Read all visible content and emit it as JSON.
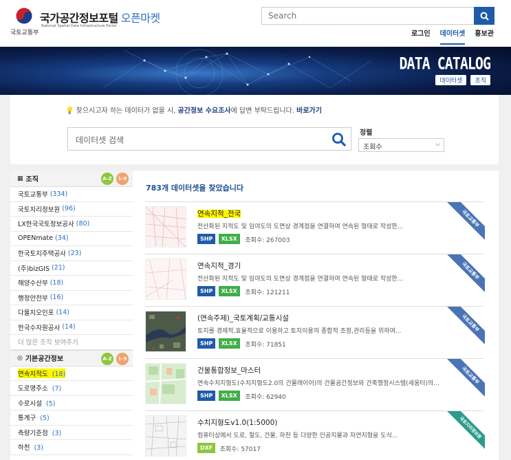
{
  "header": {
    "ministry": "국토교통부",
    "title_main": "국가공간정보포털",
    "title_market": "오픈마켓",
    "subtitle": "National Spatial Data Infrastructure Portal",
    "search_placeholder": "Search",
    "nav": [
      {
        "label": "로그인",
        "active": false
      },
      {
        "label": "데이터셋",
        "active": true
      },
      {
        "label": "홍보관",
        "active": false
      }
    ]
  },
  "banner": {
    "title": "DATA CATALOG",
    "buttons": [
      "데이터셋",
      "조직"
    ]
  },
  "search_panel": {
    "survey_pre": "찾으시고자 하는 데이터가 없을 시, ",
    "survey_link": "공간정보 수요조사",
    "survey_mid": "에 답변 부탁드립니다. ",
    "survey_go": "바로가기",
    "placeholder": "데이터셋 검색",
    "sort_label": "정렬",
    "sort_value": "조회수"
  },
  "sidebar": {
    "org_header": "조직",
    "badge_az": "A-Z",
    "badge_19": "1-9",
    "orgs": [
      {
        "name": "국토교통부",
        "count": "(334)"
      },
      {
        "name": "국토지리정보원",
        "count": "(96)"
      },
      {
        "name": "LX한국국토정보공사",
        "count": "(80)"
      },
      {
        "name": "OPENmate",
        "count": "(34)"
      },
      {
        "name": "한국토지주택공사",
        "count": "(23)"
      },
      {
        "name": "(주)bizGIS",
        "count": "(21)"
      },
      {
        "name": "해양수산부",
        "count": "(18)"
      },
      {
        "name": "행정안전부",
        "count": "(16)"
      },
      {
        "name": "다울지오인포",
        "count": "(14)"
      },
      {
        "name": "한국수자원공사",
        "count": "(14)"
      }
    ],
    "more": "더 많은 조직 보여주기",
    "cat_header": "기본공간정보",
    "cats": [
      {
        "name": "연속지적도",
        "count": "(18)",
        "highlight": true
      },
      {
        "name": "도로명주소",
        "count": "(7)",
        "highlight": false
      },
      {
        "name": "수로시설",
        "count": "(5)",
        "highlight": false
      },
      {
        "name": "통계구",
        "count": "(5)",
        "highlight": false
      },
      {
        "name": "측량기준점",
        "count": "(3)",
        "highlight": false
      },
      {
        "name": "하천",
        "count": "(3)",
        "highlight": false
      }
    ]
  },
  "results": {
    "count_text": "783개 데이터셋을 찾았습니다",
    "items": [
      {
        "title": "연속지적_전국",
        "desc": "전산화된 지적도 및 임야도의 도면상 경계점을 연결하여 연속된 형태로 작성한...",
        "formats": [
          "SHP",
          "XLSX"
        ],
        "views": "조회수: 267003",
        "org": "국토교통부",
        "highlight": true
      },
      {
        "title": "연속지적_경기",
        "desc": "전산화된 지적도 및 임야도의 도면상 경계점을 연결하여 연속된 형태로 작성한...",
        "formats": [
          "SHP",
          "XLSX"
        ],
        "views": "조회수: 121211",
        "org": "국토교통부",
        "highlight": false
      },
      {
        "title": "(연속주제)_국토계획/교통시설",
        "desc": "토지를 경제적,효율적으로 이용하고 토지이용의 종합적 조정,관리등을 위하여...",
        "formats": [
          "SHP",
          "XLSX"
        ],
        "views": "조회수: 71851",
        "org": "국토교통부",
        "highlight": false
      },
      {
        "title": "건물통합정보_마스터",
        "desc": "연속수치지형도(수치지형도2.0의 건물레이어)의 건물공간정보와 건축행정시스템(세움터)의...",
        "formats": [
          "SHP",
          "XLSX"
        ],
        "views": "조회수: 62940",
        "org": "국토교통부",
        "highlight": false
      },
      {
        "title": "수치지형도v1.0(1:5000)",
        "desc": "컴퓨터상에서 도로, 철도, 건물, 하천 등 다양한 인공지물과 자연지형을 도식...",
        "formats": [
          "DXF"
        ],
        "views": "조회수: 57017",
        "org": "국토지리정보원",
        "highlight": false
      }
    ]
  },
  "colors": {
    "primary": "#1f5ba8",
    "shp": "#1f5ba8",
    "xlsx": "#3fae49",
    "dxf": "#8dc63f",
    "highlight": "#fff700",
    "ribbon_blue": "#4a74b5",
    "ribbon_teal": "#2c9c8a"
  },
  "icons": [
    "taegeuk-emblem-icon",
    "search-icon",
    "lightbulb-icon",
    "building-icon",
    "target-icon",
    "chevron-down-icon"
  ]
}
